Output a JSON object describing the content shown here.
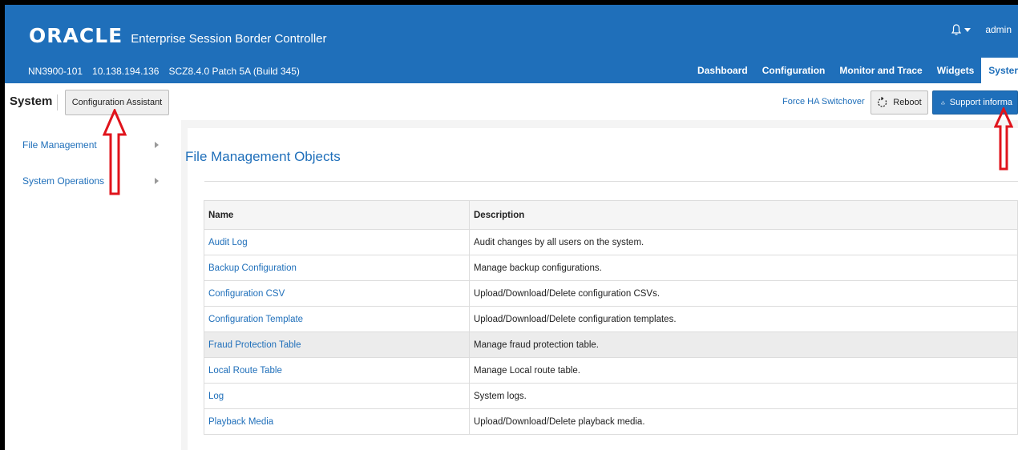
{
  "header": {
    "logo": "ORACLE",
    "product": "Enterprise Session Border Controller",
    "device_name": "NN3900-101",
    "ip_address": "10.138.194.136",
    "version": "SCZ8.4.0 Patch 5A (Build 345)",
    "user": "admin",
    "bell_icon": "bell-icon"
  },
  "topnav": {
    "tabs": [
      {
        "label": "Dashboard"
      },
      {
        "label": "Configuration"
      },
      {
        "label": "Monitor and Trace"
      },
      {
        "label": "Widgets"
      },
      {
        "label": "System"
      }
    ],
    "active_tab": "System",
    "active_tab_visible": "Syster"
  },
  "subbar": {
    "title": "System",
    "config_assistant_label": "Configuration Assistant",
    "force_ha_label": "Force HA Switchover",
    "reboot_label": "Reboot",
    "support_label": "Support information",
    "support_label_visible": "Support informa"
  },
  "leftnav": {
    "items": [
      {
        "label": "File Management"
      },
      {
        "label": "System Operations"
      }
    ]
  },
  "main": {
    "title": "File Management Objects",
    "columns": [
      "Name",
      "Description"
    ],
    "rows": [
      {
        "name": "Audit Log",
        "description": "Audit changes by all users on the system."
      },
      {
        "name": "Backup Configuration",
        "description": "Manage backup configurations."
      },
      {
        "name": "Configuration CSV",
        "description": "Upload/Download/Delete configuration CSVs."
      },
      {
        "name": "Configuration Template",
        "description": "Upload/Download/Delete configuration templates."
      },
      {
        "name": "Fraud Protection Table",
        "description": "Manage fraud protection table."
      },
      {
        "name": "Local Route Table",
        "description": "Manage Local route table."
      },
      {
        "name": "Log",
        "description": "System logs."
      },
      {
        "name": "Playback Media",
        "description": "Upload/Download/Delete playback media."
      }
    ]
  },
  "colors": {
    "brand_blue": "#1f6fba",
    "annotation_red": "#e0141c"
  }
}
